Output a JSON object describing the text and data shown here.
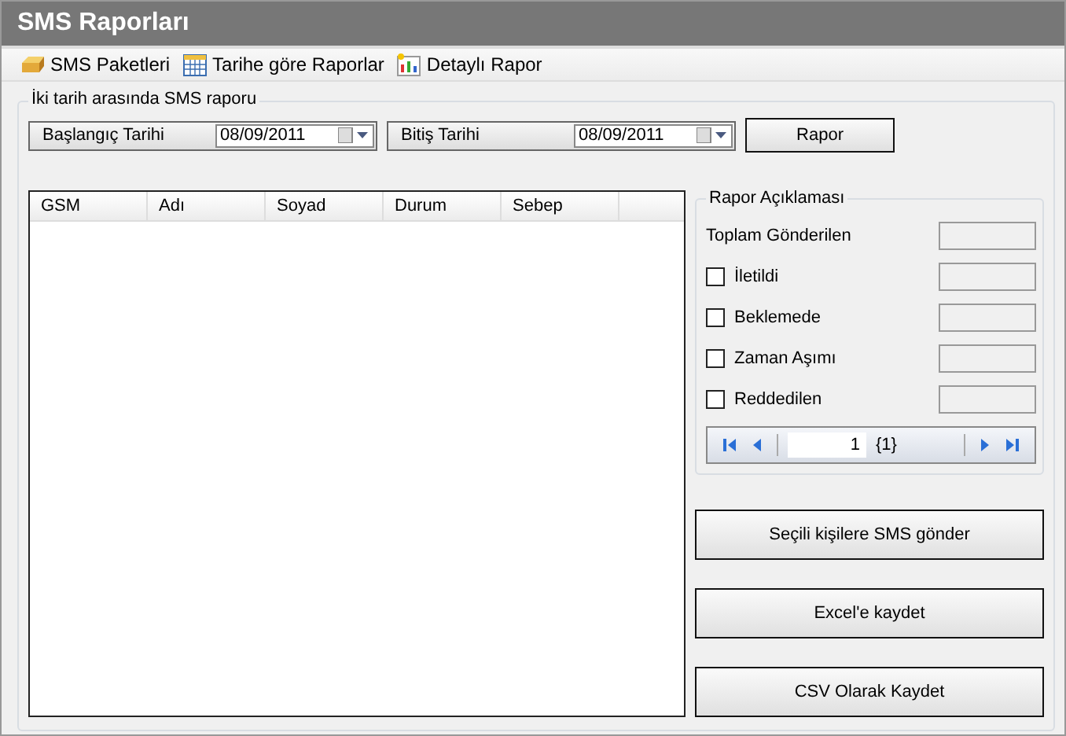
{
  "window": {
    "title": "SMS Raporları"
  },
  "toolbar": [
    {
      "label": "SMS Paketleri",
      "kind": "box"
    },
    {
      "label": "Tarihe göre Raporlar",
      "kind": "calendar"
    },
    {
      "label": "Detaylı Rapor",
      "kind": "chart"
    }
  ],
  "range": {
    "legend": "İki tarih arasında SMS raporu",
    "start_label": "Başlangıç Tarihi",
    "start_value": "08/09/2011",
    "end_label": "Bitiş Tarihi",
    "end_value": "08/09/2011",
    "button": "Rapor"
  },
  "table": {
    "columns": [
      "GSM",
      "Adı",
      "Soyad",
      "Durum",
      "Sebep"
    ]
  },
  "summary": {
    "legend": "Rapor Açıklaması",
    "items": [
      {
        "kind": "total",
        "label": "Toplam Gönderilen"
      },
      {
        "kind": "checkbox",
        "label": "İletildi",
        "checked": false
      },
      {
        "kind": "checkbox",
        "label": "Beklemede",
        "checked": false
      },
      {
        "kind": "checkbox",
        "label": "Zaman Aşımı",
        "checked": false
      },
      {
        "kind": "checkbox",
        "label": "Reddedilen",
        "checked": false
      }
    ],
    "pager": {
      "page": "1",
      "count": "{1}"
    }
  },
  "actions": [
    "Seçili kişilere SMS gönder",
    "Excel'e kaydet",
    "CSV Olarak Kaydet"
  ]
}
